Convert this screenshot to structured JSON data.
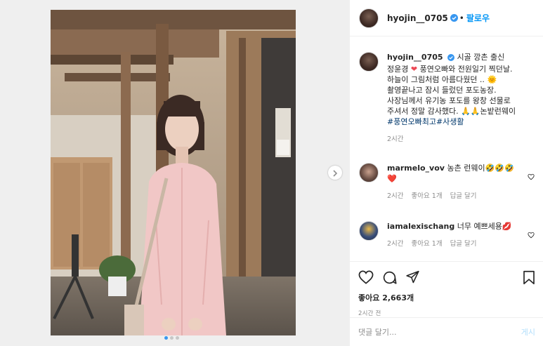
{
  "post": {
    "username": "hyojin__0705",
    "follow_label": "팔로우",
    "separator": "•",
    "caption_prefix": "시골 깡촌 출신 정윤경",
    "caption_mid1": "풍연오빠와 전원일기 찍던날. 하늘이 그림처럼 아름다웠던 ..",
    "caption_mid2": "촬영끝나고 잠시 들렀던 포도농장. 사장님께서 유기농 포도를 왕창 선물로 주셔서 정말 감사했다.",
    "caption_mid3": "논밭런웨이",
    "hashtag1": "#풍연오빠최고",
    "hashtag2": "#사생활",
    "caption_time": "2시간",
    "likes_label": "좋아요 2,663개",
    "time_ago": "2시간 전"
  },
  "comments": [
    {
      "username": "marmelo_vov",
      "text": "농촌 런웨이🤣🤣🤣❤️",
      "time": "2시간",
      "likes": "좋아요 1개",
      "reply": "답글 달기"
    },
    {
      "username": "iamalexischang",
      "text": "너무 예쁘세용💋",
      "time": "2시간",
      "likes": "좋아요 1개",
      "reply": "답글 달기"
    }
  ],
  "comment_box": {
    "placeholder": "댓글 달기...",
    "post_label": "게시"
  },
  "carousel": {
    "total": 3,
    "active": 0
  },
  "colors": {
    "accent": "#0095f6",
    "verified": "#3897f0",
    "heart": "#ed4956",
    "hashtag": "#00376b"
  }
}
